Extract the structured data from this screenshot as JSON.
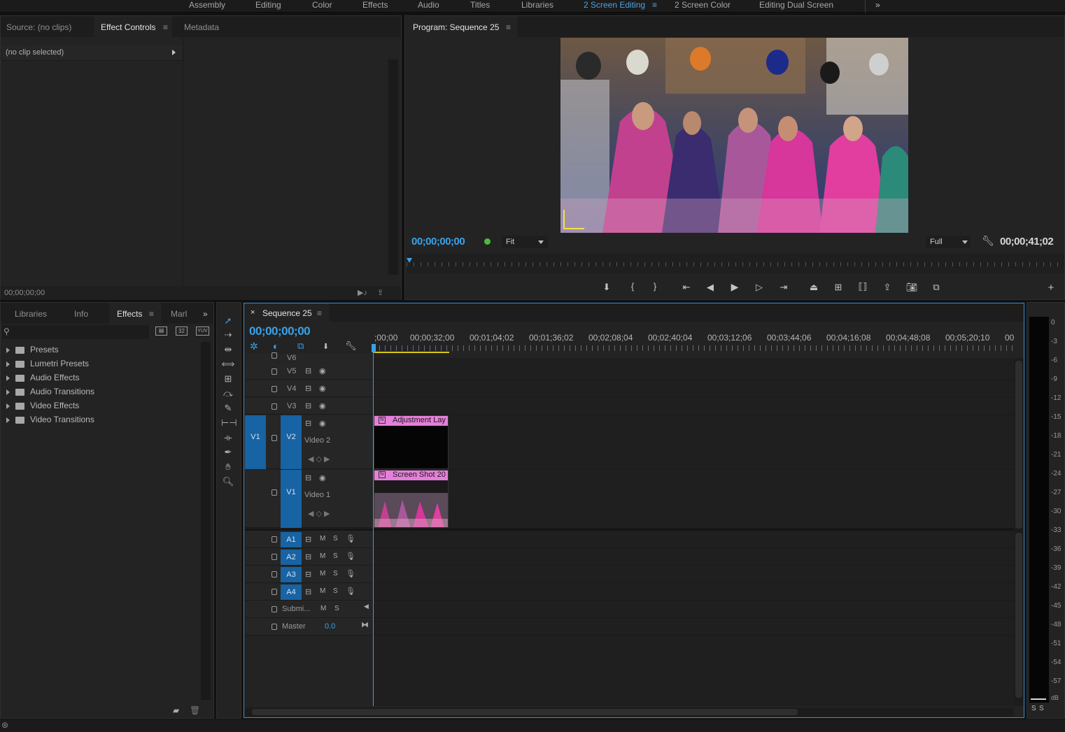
{
  "workspaces": {
    "items": [
      "Assembly",
      "Editing",
      "Color",
      "Effects",
      "Audio",
      "Titles",
      "Libraries",
      "2 Screen Editing",
      "2 Screen Color",
      "Editing Dual Screen"
    ],
    "active_index": 7,
    "overflow": "»"
  },
  "source_panel": {
    "tabs": [
      "Source: (no clips)",
      "Effect Controls",
      "Metadata"
    ],
    "active_tab": "Effect Controls",
    "clip_label": "(no clip selected)",
    "timecode": "00;00;00;00"
  },
  "program_monitor": {
    "title": "Program: Sequence 25",
    "timecode_left": "00;00;00;00",
    "fit": "Fit",
    "quality": "Full",
    "timecode_right": "00;00;41;02",
    "preview_image": "wedding-gathering-photo"
  },
  "project_panel": {
    "tabs": [
      "Libraries",
      "Info",
      "Effects",
      "Marl"
    ],
    "active_tab": "Effects",
    "toolbar_badges": [
      "32",
      "YUV"
    ],
    "tree": [
      "Presets",
      "Lumetri Presets",
      "Audio Effects",
      "Audio Transitions",
      "Video Effects",
      "Video Transitions"
    ]
  },
  "timeline": {
    "title": "Sequence 25",
    "timecode": "00;00;00;00",
    "ruler": [
      ";00;00",
      "00;00;32;00",
      "00;01;04;02",
      "00;01;36;02",
      "00;02;08;04",
      "00;02;40;04",
      "00;03;12;06",
      "00;03;44;06",
      "00;04;16;08",
      "00;04;48;08",
      "00;05;20;10",
      "00"
    ],
    "video_tracks": [
      "V6",
      "V5",
      "V4",
      "V3",
      "V2",
      "V1"
    ],
    "source_patch": "V1",
    "track_names": {
      "v2": "Video 2",
      "v1": "Video 1"
    },
    "audio_tracks": [
      "A1",
      "A2",
      "A3",
      "A4"
    ],
    "ms": [
      "M",
      "S"
    ],
    "submix": "Submi...",
    "master": "Master",
    "master_value": "0.0",
    "clips": {
      "adjustment": "Adjustment Lay",
      "screenshot": "Screen Shot 20"
    }
  },
  "audio_meter": {
    "labels": [
      "0",
      "-3",
      "-6",
      "-9",
      "-12",
      "-15",
      "-18",
      "-21",
      "-24",
      "-27",
      "-30",
      "-33",
      "-36",
      "-39",
      "-42",
      "-45",
      "-48",
      "-51",
      "-54",
      "-57",
      "dB"
    ],
    "solo": [
      "S",
      "S"
    ]
  },
  "colors": {
    "accent": "#3aa1e8",
    "track_target": "#1763a3",
    "clip_pink": "#e57fd9",
    "playhead": "#3aa1e8",
    "work_area": "#d8c81a"
  }
}
